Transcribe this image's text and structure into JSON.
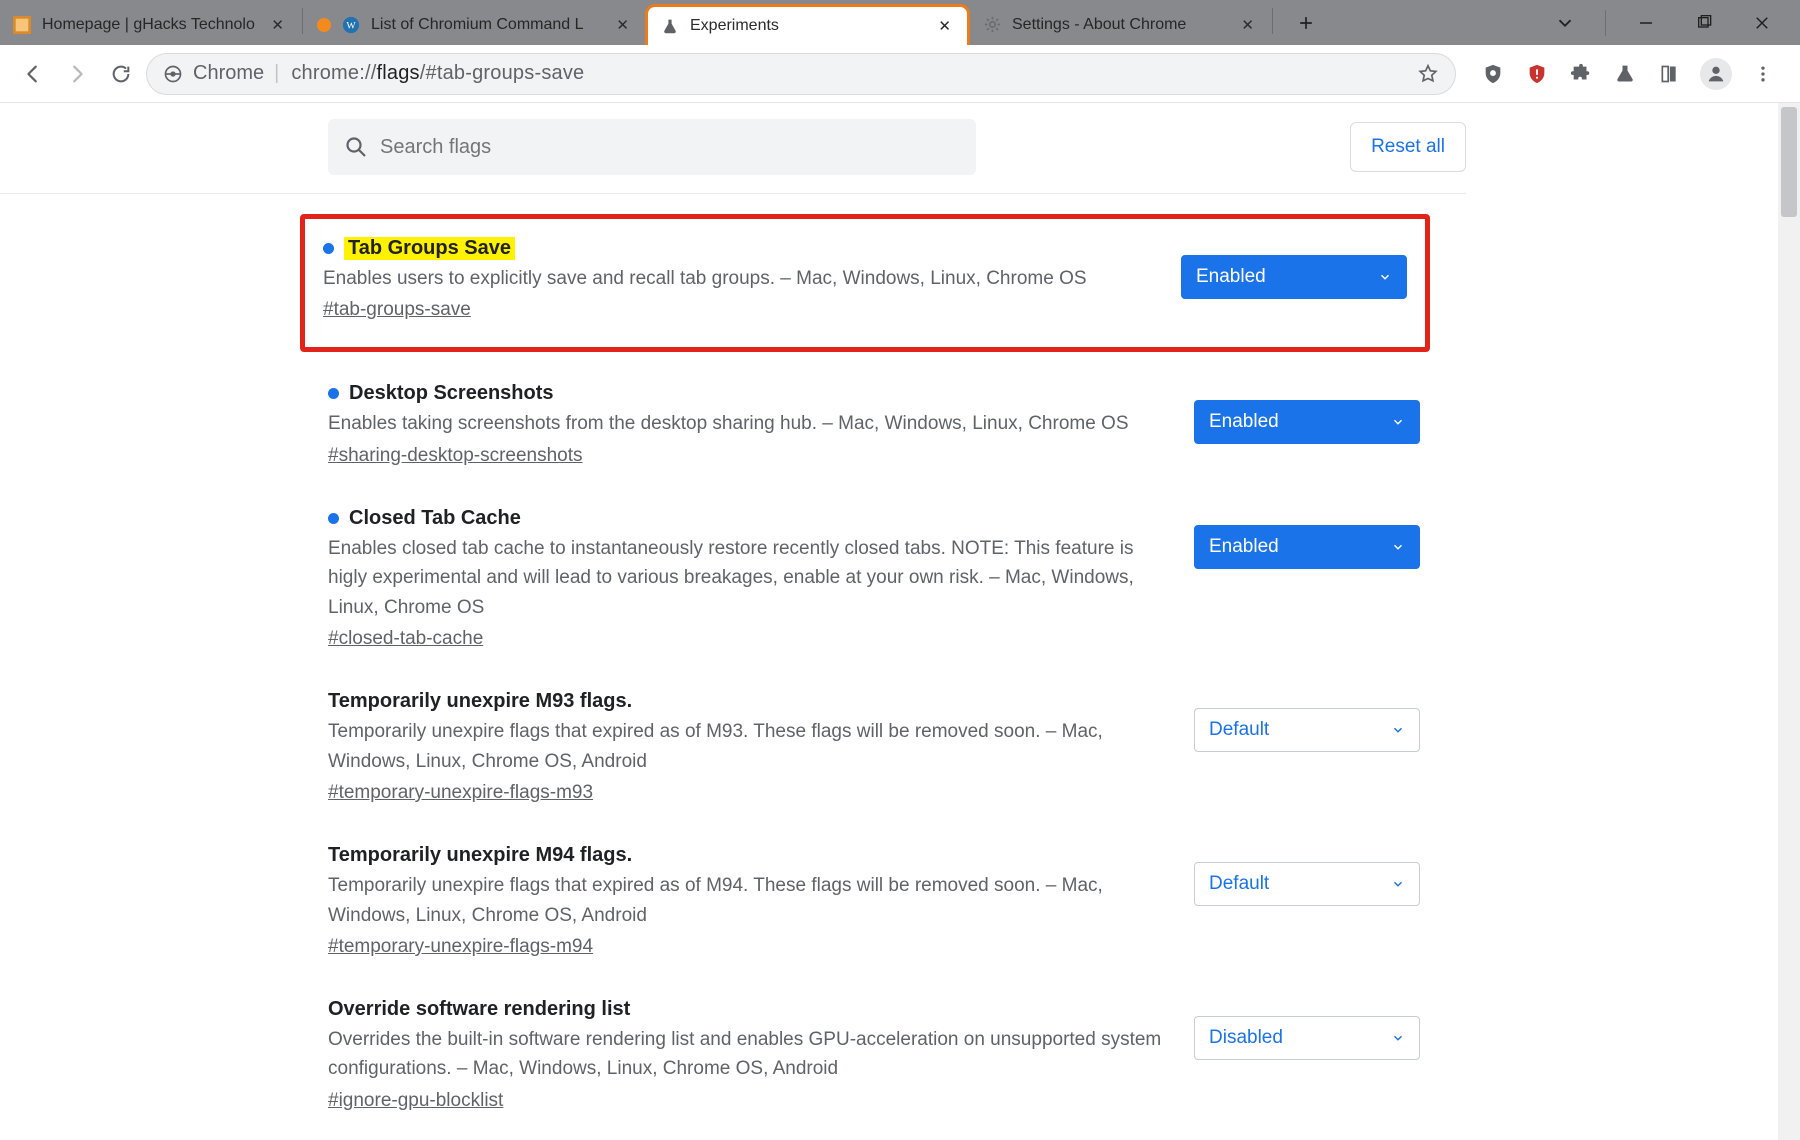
{
  "window": {
    "controls": {
      "chevron": "⌄",
      "minimize": "—",
      "maximize": "❐",
      "close": "✕"
    }
  },
  "tabs": [
    {
      "label": "Homepage | gHacks Technolo",
      "active": false,
      "favicon": "ghacks"
    },
    {
      "label": "List of Chromium Command L",
      "active": false,
      "favicon": "wp",
      "orange_dot": true
    },
    {
      "label": "Experiments",
      "active": true,
      "favicon": "flask"
    },
    {
      "label": "Settings - About Chrome",
      "active": false,
      "favicon": "gear"
    }
  ],
  "newtab_label": "+",
  "urlbar": {
    "secure_label": "Chrome",
    "url_plain": "chrome://",
    "url_dark": "flags",
    "url_rest": "/#tab-groups-save"
  },
  "ext_icons": [
    "ublock",
    "shield",
    "puzzle",
    "flask",
    "read",
    "avatar",
    "kebab"
  ],
  "page": {
    "search_placeholder": "Search flags",
    "reset_label": "Reset all"
  },
  "flags": [
    {
      "title": "Tab Groups Save",
      "desc": "Enables users to explicitly save and recall tab groups. – Mac, Windows, Linux, Chrome OS",
      "anchor": "#tab-groups-save",
      "select": "Enabled",
      "style": "blue",
      "dot": true,
      "highlight": true,
      "boxed": true
    },
    {
      "title": "Desktop Screenshots",
      "desc": "Enables taking screenshots from the desktop sharing hub. – Mac, Windows, Linux, Chrome OS",
      "anchor": "#sharing-desktop-screenshots",
      "select": "Enabled",
      "style": "blue",
      "dot": true
    },
    {
      "title": "Closed Tab Cache",
      "desc": "Enables closed tab cache to instantaneously restore recently closed tabs. NOTE: This feature is higly experimental and will lead to various breakages, enable at your own risk. – Mac, Windows, Linux, Chrome OS",
      "anchor": "#closed-tab-cache",
      "select": "Enabled",
      "style": "blue",
      "dot": true
    },
    {
      "title": "Temporarily unexpire M93 flags.",
      "desc": "Temporarily unexpire flags that expired as of M93. These flags will be removed soon. – Mac, Windows, Linux, Chrome OS, Android",
      "anchor": "#temporary-unexpire-flags-m93",
      "select": "Default",
      "style": "outline",
      "dot": false
    },
    {
      "title": "Temporarily unexpire M94 flags.",
      "desc": "Temporarily unexpire flags that expired as of M94. These flags will be removed soon. – Mac, Windows, Linux, Chrome OS, Android",
      "anchor": "#temporary-unexpire-flags-m94",
      "select": "Default",
      "style": "outline",
      "dot": false
    },
    {
      "title": "Override software rendering list",
      "desc": "Overrides the built-in software rendering list and enables GPU-acceleration on unsupported system configurations. – Mac, Windows, Linux, Chrome OS, Android",
      "anchor": "#ignore-gpu-blocklist",
      "select": "Disabled",
      "style": "outline",
      "dot": false
    }
  ]
}
